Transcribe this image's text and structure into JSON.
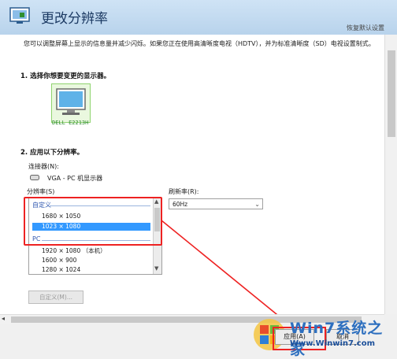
{
  "header": {
    "title": "更改分辨率",
    "restore_defaults": "恢复默认设置"
  },
  "description": "您可以调整屏幕上显示的信息量并减少闪烁。如果您正在使用高清晰度电视（HDTV），并为标准清晰度（SD）电视设置制式。",
  "section1": {
    "heading": "1. 选择你想要变更的显示器。",
    "monitor_name": "DELL E2213H"
  },
  "section2": {
    "heading": "2. 应用以下分辨率。",
    "connector_label": "连接器(N):",
    "connector_value": "VGA - PC 机显示器",
    "resolution_label": "分辨率(S)",
    "refresh_label": "刷新率(R):",
    "refresh_value": "60Hz",
    "group_custom": "自定义",
    "custom_items": [
      "1680 × 1050",
      "1023 × 1080"
    ],
    "group_pc": "PC",
    "pc_items": [
      "1920 × 1080 （本机）",
      "1600 × 900",
      "1280 × 1024"
    ],
    "custom_button": "自定义(M)..."
  },
  "footer": {
    "apply": "应用(A)",
    "cancel": "取消"
  },
  "watermark": {
    "brand": "Win7系统之家",
    "url": "Www.Winwin7.com"
  },
  "colors": {
    "highlight": "#ee2222",
    "selection": "#3399ff",
    "monitor_accent": "#8fd36e"
  }
}
